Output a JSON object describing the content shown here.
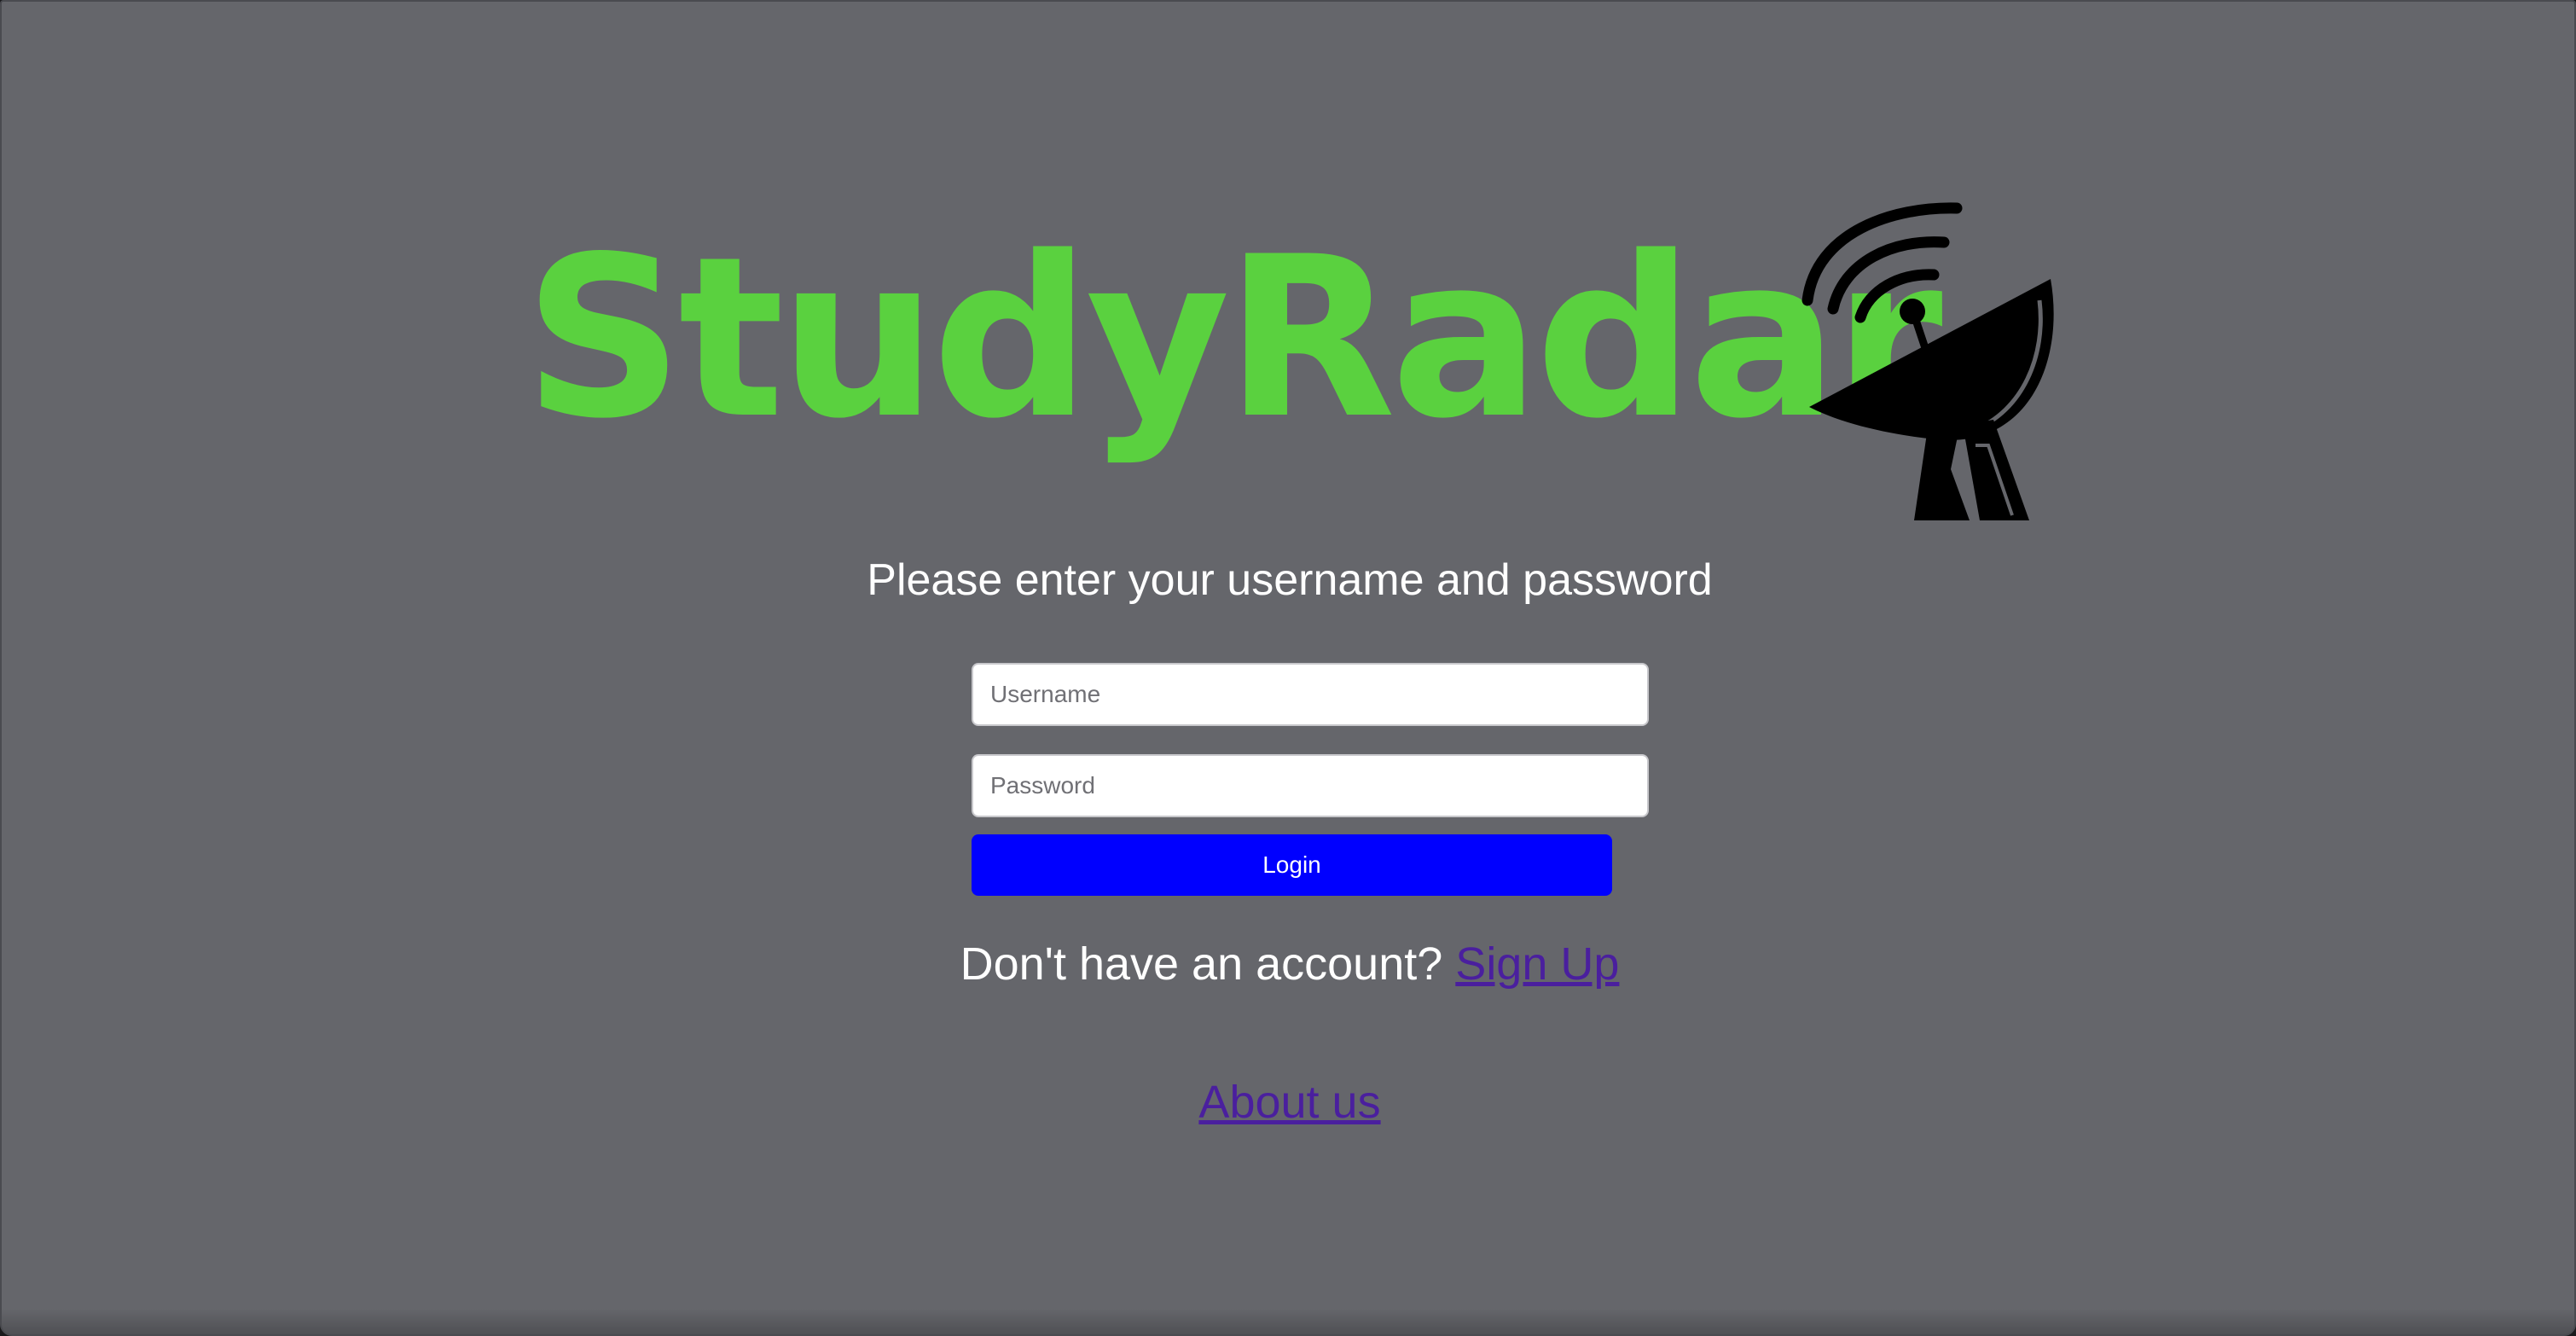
{
  "logo": {
    "text": "StudyRadar",
    "text_color": "#5ad13f",
    "icon": "satellite-dish-icon"
  },
  "login_form": {
    "prompt": "Please enter your username and password",
    "username_placeholder": "Username",
    "password_placeholder": "Password",
    "username_value": "",
    "password_value": "",
    "login_label": "Login",
    "login_color": "#0000ff"
  },
  "signup": {
    "question": "Don't have an account?",
    "link_label": "Sign Up"
  },
  "footer": {
    "about_label": "About us"
  },
  "colors": {
    "background": "#65666b",
    "link": "#4a1f9e",
    "text": "#ffffff"
  }
}
